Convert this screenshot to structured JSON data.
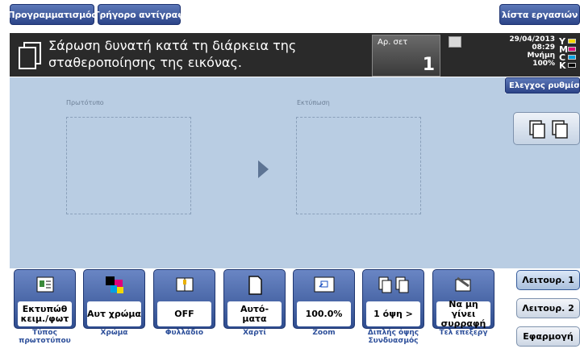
{
  "top_tabs": {
    "programming": "Προγραμματισμός",
    "quick_copy": "Γρήγορο αντίγραφ",
    "job_list": "λίστα εργασιών"
  },
  "message": {
    "line1": "Σάρωση δυνατή κατά τη διάρκεια της",
    "line2": "σταθεροποίησης της εικόνας.",
    "icon": "document-icon"
  },
  "sets": {
    "label": "Αρ. σετ",
    "count": "1"
  },
  "status": {
    "date": "29/04/2013",
    "time": "08:29",
    "memory_label": "Μνήμη",
    "memory_value": "100%"
  },
  "toner": [
    {
      "letter": "Y",
      "color": "#f4d800"
    },
    {
      "letter": "M",
      "color": "#e0007a"
    },
    {
      "letter": "C",
      "color": "#00a0e0"
    },
    {
      "letter": "K",
      "color": "#000000"
    }
  ],
  "preview": {
    "original_label": "Πρωτότυπο",
    "output_label": "Εκτύπωση"
  },
  "check_settings": "Ελεγχος ρυθμίσεων",
  "function_keys": [
    {
      "value": "Εκτυπώθ κειμ./φωτ",
      "caption": "Τύπος πρωτοτύπου",
      "icon": "original-type-icon"
    },
    {
      "value": "Αυτ χρώμα",
      "caption": "Χρώμα",
      "icon": "color-icon"
    },
    {
      "value": "OFF",
      "caption": "Φυλλάδιο",
      "icon": "booklet-icon"
    },
    {
      "value": "Αυτό- ματα",
      "caption": "Χαρτί",
      "icon": "paper-icon"
    },
    {
      "value": "100.0%",
      "caption": "Zoom",
      "icon": "zoom-icon"
    },
    {
      "value": "1 όψη >",
      "caption": "Διπλής όψης Συνδυασμός",
      "icon": "duplex-combine-icon"
    },
    {
      "value": "Να μη γίνει συρραφή",
      "caption": "Τελ επεξεργ",
      "icon": "finishing-icon"
    }
  ],
  "mode_buttons": {
    "function1": "Λειτουρ. 1",
    "function2": "Λειτουρ. 2",
    "application": "Εφαρμογή"
  },
  "colors": {
    "accent": "#2c4488",
    "panel": "#b9cde3",
    "caption": "#2d4f9a"
  }
}
